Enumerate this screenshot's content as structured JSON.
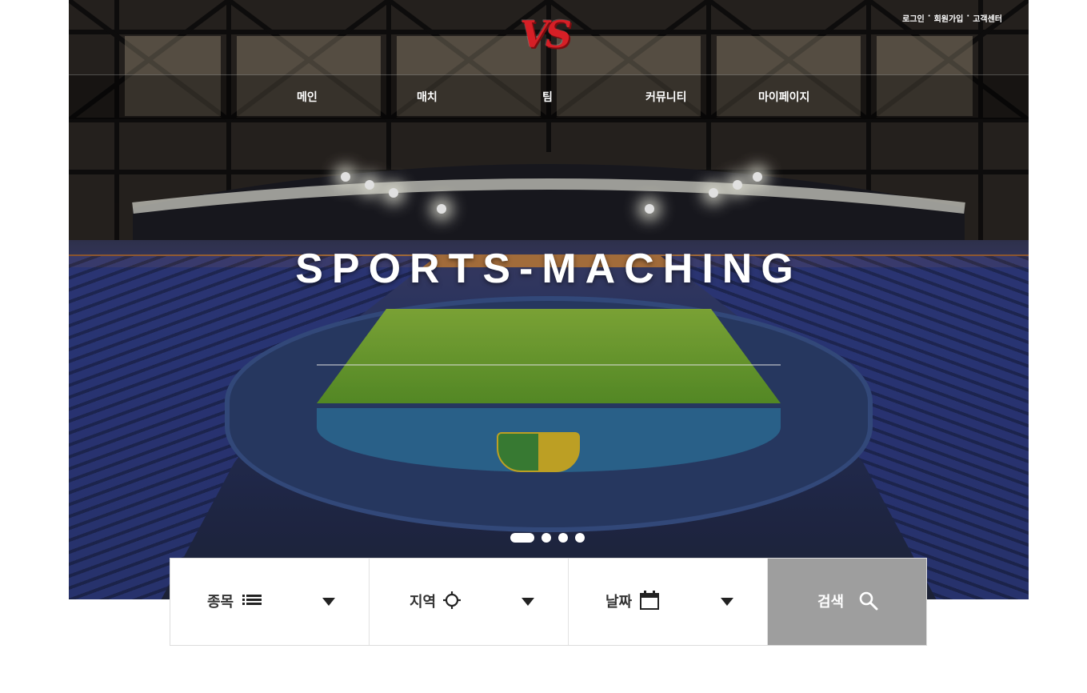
{
  "header": {
    "logo_text": "VS",
    "util_links": [
      "로그인",
      "회원가입",
      "고객센터"
    ],
    "util_separator": "·"
  },
  "nav": {
    "items": [
      "메인",
      "매치",
      "팀",
      "커뮤니티",
      "마이페이지"
    ]
  },
  "hero": {
    "title": "SPORTS-MACHING",
    "slides_total": 4,
    "slide_active": 1
  },
  "search": {
    "sport_label": "종목",
    "sport_icon": "list-icon",
    "region_label": "지역",
    "region_icon": "crosshair-icon",
    "date_label": "날짜",
    "date_icon": "calendar-icon",
    "submit_label": "검색",
    "submit_icon": "search-icon"
  },
  "colors": {
    "logo_red": "#d61f26",
    "search_button": "#9e9e9e",
    "text_dark": "#333333"
  }
}
